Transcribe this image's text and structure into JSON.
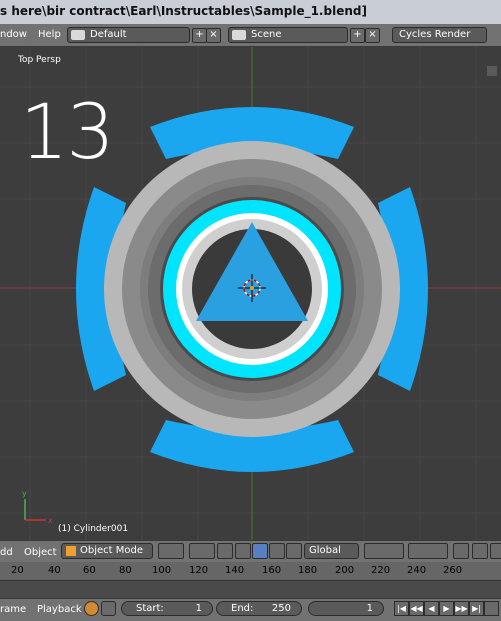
{
  "window": {
    "title": "s here\\bir contract\\Earl\\Instructables\\Sample_1.blend]"
  },
  "menubar": {
    "window_menu": "ndow",
    "help_menu": "Help",
    "layout_value": "Default",
    "scene_value": "Scene",
    "render_engine": "Cycles Render"
  },
  "viewport": {
    "view_label": "Top Persp",
    "frame_number": "13",
    "object_label": "(1) Cylinder001",
    "colors": {
      "background": "#3d3d3d",
      "cyan_ring": "#00e5ff",
      "blue_segments": "#1aa7f0",
      "triangle": "#2aa0e0"
    }
  },
  "header3d": {
    "add_menu": "dd",
    "object_menu": "Object",
    "mode_value": "Object Mode",
    "orientation_value": "Global"
  },
  "timeline": {
    "ticks": [
      "20",
      "40",
      "60",
      "80",
      "100",
      "120",
      "140",
      "160",
      "180",
      "200",
      "220",
      "240",
      "260"
    ]
  },
  "playback": {
    "frame_menu": "rame",
    "playback_menu": "Playback",
    "start_label": "Start:",
    "start_value": "1",
    "end_label": "End:",
    "end_value": "250",
    "current_frame": "1"
  }
}
